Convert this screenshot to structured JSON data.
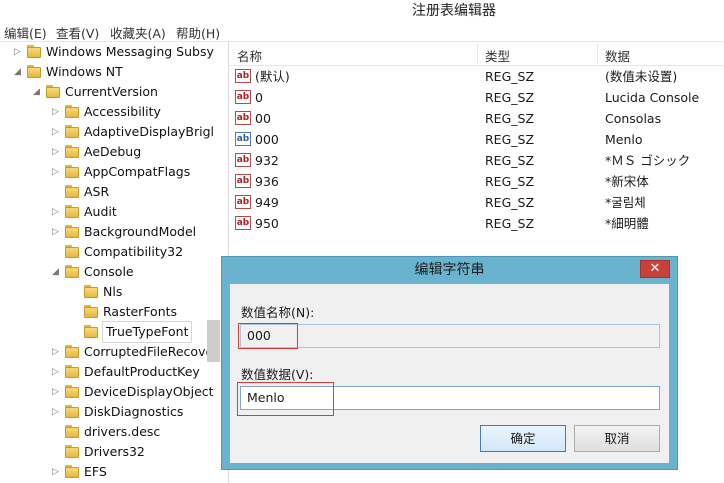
{
  "window": {
    "title": "注册表编辑器"
  },
  "menu": [
    {
      "label": "编辑(E)"
    },
    {
      "label": "查看(V)"
    },
    {
      "label": "收藏夹(A)"
    },
    {
      "label": "帮助(H)"
    }
  ],
  "tree": [
    {
      "label": "Windows Messaging Subsy",
      "arrow": "▷"
    },
    {
      "label": "Windows NT",
      "arrow": "◢"
    },
    {
      "label": "CurrentVersion",
      "arrow": "◢"
    },
    {
      "label": "Accessibility",
      "arrow": "▷"
    },
    {
      "label": "AdaptiveDisplayBrigl",
      "arrow": "▷"
    },
    {
      "label": "AeDebug",
      "arrow": "▷"
    },
    {
      "label": "AppCompatFlags",
      "arrow": "▷"
    },
    {
      "label": "ASR",
      "arrow": ""
    },
    {
      "label": "Audit",
      "arrow": "▷"
    },
    {
      "label": "BackgroundModel",
      "arrow": "▷"
    },
    {
      "label": "Compatibility32",
      "arrow": ""
    },
    {
      "label": "Console",
      "arrow": "◢"
    },
    {
      "label": "Nls",
      "arrow": ""
    },
    {
      "label": "RasterFonts",
      "arrow": ""
    },
    {
      "label": "TrueTypeFont",
      "arrow": ""
    },
    {
      "label": "CorruptedFileRecove",
      "arrow": "▷"
    },
    {
      "label": "DefaultProductKey",
      "arrow": "▷"
    },
    {
      "label": "DeviceDisplayObject",
      "arrow": "▷"
    },
    {
      "label": "DiskDiagnostics",
      "arrow": "▷"
    },
    {
      "label": "drivers.desc",
      "arrow": ""
    },
    {
      "label": "Drivers32",
      "arrow": ""
    },
    {
      "label": "EFS",
      "arrow": "▷"
    }
  ],
  "list": {
    "columns": {
      "name": "名称",
      "type": "类型",
      "data": "数据"
    },
    "icon_text": "ab",
    "rows": [
      {
        "name": "(默认)",
        "type": "REG_SZ",
        "data": "(数值未设置)"
      },
      {
        "name": "0",
        "type": "REG_SZ",
        "data": "Lucida Console"
      },
      {
        "name": "00",
        "type": "REG_SZ",
        "data": "Consolas"
      },
      {
        "name": "000",
        "type": "REG_SZ",
        "data": "Menlo"
      },
      {
        "name": "932",
        "type": "REG_SZ",
        "data": "*ＭＳ ゴシック"
      },
      {
        "name": "936",
        "type": "REG_SZ",
        "data": "*新宋体"
      },
      {
        "name": "949",
        "type": "REG_SZ",
        "data": "*굴림체"
      },
      {
        "name": "950",
        "type": "REG_SZ",
        "data": "*細明體"
      }
    ]
  },
  "dialog": {
    "title": "编辑字符串",
    "close_glyph": "✕",
    "name_label": "数值名称(N):",
    "name_value": "000",
    "data_label": "数值数据(V):",
    "data_value": "Menlo",
    "ok_label": "确定",
    "cancel_label": "取消"
  }
}
